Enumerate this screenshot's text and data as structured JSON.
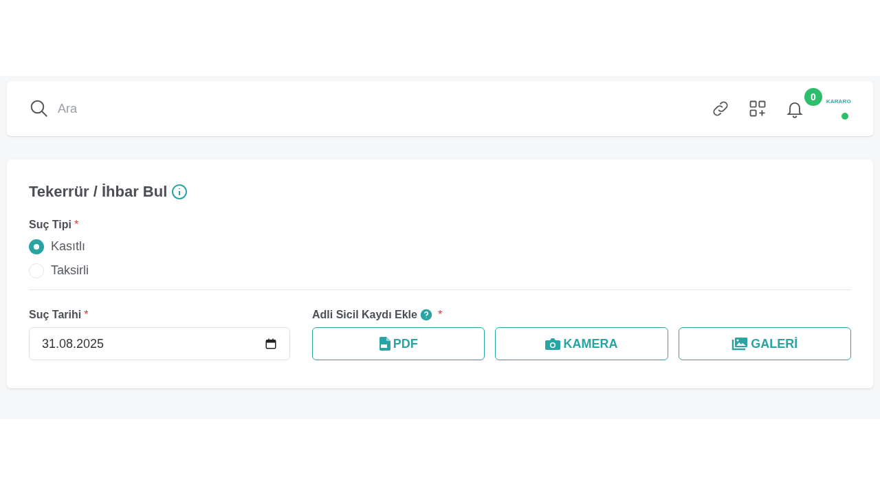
{
  "search": {
    "placeholder": "Ara"
  },
  "header": {
    "notification_count": "0",
    "logo_text": "KARARO",
    "online": true
  },
  "card": {
    "title": "Tekerrür / İhbar Bul",
    "crime_type": {
      "label": "Suç Tipi",
      "required_mark": "*",
      "options": [
        {
          "label": "Kasıtlı",
          "selected": true
        },
        {
          "label": "Taksirli",
          "selected": false
        }
      ]
    },
    "crime_date": {
      "label": "Suç Tarihi",
      "required_mark": "*",
      "value": "31.08.2025"
    },
    "record": {
      "label": "Adli Sicil Kaydı Ekle",
      "required_mark": "*",
      "buttons": [
        {
          "kind": "pdf",
          "label": "PDF"
        },
        {
          "kind": "camera",
          "label": "KAMERA"
        },
        {
          "kind": "gallery",
          "label": "GALERİ"
        }
      ]
    }
  }
}
